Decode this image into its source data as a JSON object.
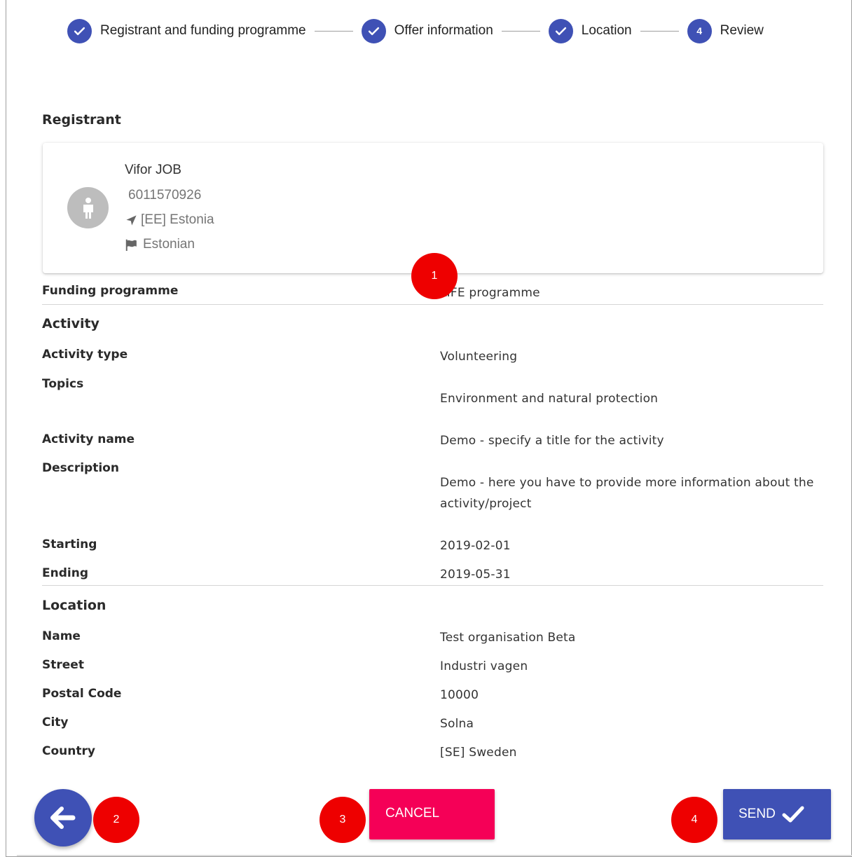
{
  "stepper": {
    "steps": [
      {
        "label": "Registrant and funding programme",
        "state": "done"
      },
      {
        "label": "Offer information",
        "state": "done"
      },
      {
        "label": "Location",
        "state": "done"
      },
      {
        "label": "Review",
        "state": "active",
        "number": "4"
      }
    ]
  },
  "registrant": {
    "heading": "Registrant",
    "name": "Vifor JOB",
    "id": "6011570926",
    "country": "[EE] Estonia",
    "nationality": "Estonian",
    "icons": {
      "avatar": "person-icon",
      "country": "location-arrow-icon",
      "nationality": "flag-icon"
    }
  },
  "funding": {
    "label": "Funding programme",
    "value": "LIFE programme"
  },
  "activity": {
    "heading": "Activity",
    "type": {
      "label": "Activity type",
      "value": "Volunteering"
    },
    "topics": {
      "label": "Topics",
      "value": "Environment and natural protection"
    },
    "name": {
      "label": "Activity name",
      "value": "Demo - specify a title for the activity"
    },
    "description": {
      "label": "Description",
      "value": "Demo - here you have to provide more information about the activity/project"
    },
    "starting": {
      "label": "Starting",
      "value": "2019-02-01"
    },
    "ending": {
      "label": "Ending",
      "value": "2019-05-31"
    }
  },
  "location": {
    "heading": "Location",
    "name": {
      "label": "Name",
      "value": "Test organisation Beta"
    },
    "street": {
      "label": "Street",
      "value": "Industri vagen"
    },
    "postal": {
      "label": "Postal Code",
      "value": "10000"
    },
    "city": {
      "label": "City",
      "value": "Solna"
    },
    "country": {
      "label": "Country",
      "value": "[SE] Sweden"
    }
  },
  "markers": [
    "1",
    "2",
    "3",
    "4"
  ],
  "actions": {
    "cancel": "CANCEL",
    "send": "SEND"
  },
  "colors": {
    "primary": "#3f51b5",
    "accent": "#f50057",
    "marker": "#ee0000"
  }
}
